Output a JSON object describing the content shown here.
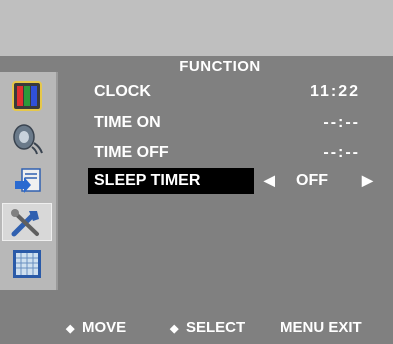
{
  "menu": {
    "title": "FUNCTION",
    "rows": [
      {
        "label": "CLOCK",
        "value": "11:22"
      },
      {
        "label": "TIME ON",
        "value": "--:--"
      },
      {
        "label": "TIME OFF",
        "value": "--:--"
      },
      {
        "label": "SLEEP TIMER",
        "value": "OFF",
        "left_arrow": "◀",
        "right_arrow": "▶"
      }
    ]
  },
  "sidebar": {
    "icons": [
      "picture-icon",
      "sound-icon",
      "setup-icon",
      "function-icon",
      "tv-icon"
    ],
    "active": "function-icon"
  },
  "footer": {
    "move_symbol": "◆",
    "move_label": "MOVE",
    "select_symbol": "◆",
    "select_label": "SELECT",
    "menu_exit_label": "MENU EXIT"
  },
  "colors": {
    "background": "#808080",
    "top_band": "#bfbfbf",
    "sidebar": "#b8b8b8",
    "highlight": "#000000",
    "text": "#ffffff"
  }
}
